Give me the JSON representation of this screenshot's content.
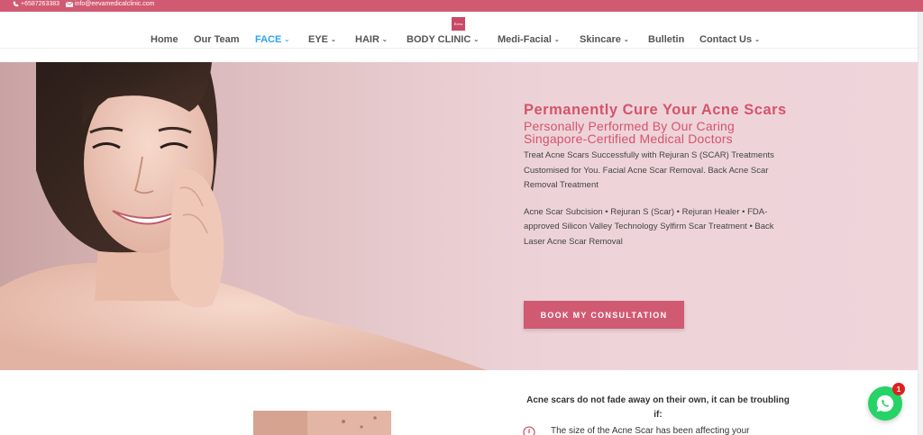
{
  "topbar": {
    "phone": "+6587263383",
    "email": "info@eevamedicalclinic.com"
  },
  "logo": {
    "text": "Eeva"
  },
  "nav": {
    "items": [
      {
        "label": "Home"
      },
      {
        "label": "Our Team"
      },
      {
        "label": "FACE"
      },
      {
        "label": "EYE"
      },
      {
        "label": "HAIR"
      },
      {
        "label": "BODY CLINIC"
      },
      {
        "label": "Medi-Facial"
      },
      {
        "label": "Skincare"
      },
      {
        "label": "Bulletin"
      },
      {
        "label": "Contact Us"
      }
    ],
    "active": "FACE"
  },
  "hero": {
    "title": "Permanently Cure Your Acne Scars",
    "subtitle": "Personally Performed By Our Caring Singapore-Certified Medical Doctors",
    "paragraph1": "Treat Acne Scars Successfully with Rejuran S (SCAR) Treatments Customised for You. Facial Acne Scar Removal. Back Acne Scar Removal Treatment",
    "paragraph2": "Acne Scar Subcision • Rejuran S (Scar) • Rejuran Healer • FDA-approved Silicon Valley Technology Sylfirm Scar Treatment • Back Laser Acne Scar Removal",
    "cta": "BOOK MY CONSULTATION"
  },
  "section2": {
    "heading": "Acne scars do not fade away on their own, it can be troubling if:",
    "item1": "The size of the Acne Scar has been affecting your"
  },
  "whatsapp": {
    "badge": "1"
  },
  "colors": {
    "brand": "#d15a73",
    "active_nav": "#2ea3f2",
    "whatsapp": "#25d366"
  }
}
